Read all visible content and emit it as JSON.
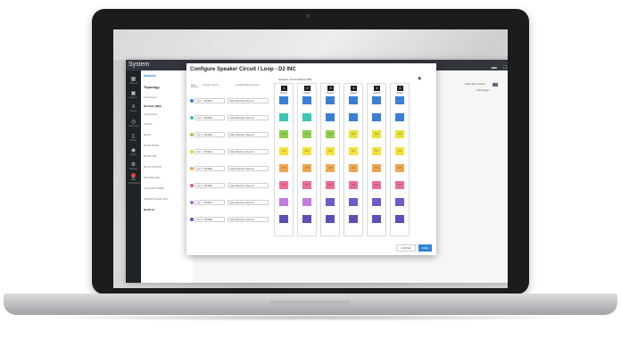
{
  "app": {
    "title": "System",
    "rail": [
      {
        "icon": "grid-icon",
        "label": "Network"
      },
      {
        "icon": "monitor-icon",
        "label": "Devices"
      },
      {
        "icon": "sliders-icon",
        "label": "Zones"
      },
      {
        "icon": "timer-icon",
        "label": "Schedules"
      },
      {
        "icon": "tablet-icon",
        "label": "Panels"
      },
      {
        "icon": "bell-icon",
        "label": "Alarms"
      },
      {
        "icon": "gear-icon",
        "label": "Settings"
      },
      {
        "icon": "alert-icon",
        "label": "Notifications"
      }
    ]
  },
  "sidebar": {
    "title": "Network",
    "subtitle": "Topology",
    "items": [
      "All Devices",
      "D2 Rack (MM)",
      "Add Device",
      "G BOX",
      "RACK",
      "B4 BCSDS8",
      "B5 BCTD8",
      "D8 NC D4NSD",
      "SB AMPLXE4",
      "CLOUDPLX0200",
      "CPARKSTAGE COS",
      "RACK B"
    ]
  },
  "header_right": {
    "label_a": "Adjust Slave Volume",
    "label_b": "Grid Settings"
  },
  "dialog": {
    "title": "Configure Speaker Circuit / Loop - D2 INC",
    "modes_title": "Speaker Circuit Modes (8/8)",
    "col_input": "Input Channel",
    "col_amplifier": "Amplifier Channel",
    "col_backup": "Amplifier Backup Channel",
    "outputs": [
      {
        "num": "1",
        "name": "Default"
      },
      {
        "num": "2",
        "name": "Default"
      },
      {
        "num": "3",
        "name": "Default"
      },
      {
        "num": "4",
        "name": "Default"
      },
      {
        "num": "5",
        "name": "Default"
      },
      {
        "num": "6",
        "name": "Default"
      }
    ],
    "rows": [
      {
        "dot": "#2d7fd3",
        "channel": "CH 1 - MODE1...",
        "backup": "Select Backup Channel",
        "cells": [
          {
            "c": "#3a7fd6",
            "t": ""
          },
          {
            "c": "#3a7fd6",
            "t": ""
          },
          {
            "c": "#3a7fd6",
            "t": ""
          },
          {
            "c": "#3a7fd6",
            "t": ""
          },
          {
            "c": "#3a7fd6",
            "t": ""
          },
          {
            "c": "#3a7fd6",
            "t": ""
          }
        ]
      },
      {
        "dot": "#3ec3b7",
        "channel": "CH 2 - MODE2...",
        "backup": "Select Backup Channel",
        "cells": [
          {
            "c": "#3ec3b7",
            "t": ""
          },
          {
            "c": "#3ec3b7",
            "t": ""
          },
          {
            "c": "#3a7fd6",
            "t": ""
          },
          {
            "c": "#3a7fd6",
            "t": ""
          },
          {
            "c": "#3a7fd6",
            "t": ""
          },
          {
            "c": "#3a7fd6",
            "t": ""
          }
        ]
      },
      {
        "dot": "#8fcf4e",
        "channel": "CH 3 - MODE3...",
        "backup": "Select Backup Channel",
        "cells": [
          {
            "c": "#8fcf4e",
            "t": "1.3"
          },
          {
            "c": "#8fcf4e",
            "t": "1.3"
          },
          {
            "c": "#8fcf4e",
            "t": "1.3"
          },
          {
            "c": "#e7e238",
            "t": "4.3"
          },
          {
            "c": "#e7e238",
            "t": "5.3"
          },
          {
            "c": "#e7e238",
            "t": "6.3"
          }
        ]
      },
      {
        "dot": "#e7d031",
        "channel": "CH 4 - MODE4...",
        "backup": "Select Backup Channel",
        "cells": [
          {
            "c": "#f4e13a",
            "t": "1.4"
          },
          {
            "c": "#f4e13a",
            "t": "2.4"
          },
          {
            "c": "#f4e13a",
            "t": "3.4"
          },
          {
            "c": "#f4e13a",
            "t": "4.4"
          },
          {
            "c": "#f4e13a",
            "t": "5.4"
          },
          {
            "c": "#f4e13a",
            "t": "6.4"
          }
        ]
      },
      {
        "dot": "#f0a24a",
        "channel": "CH 5 - MODE5...",
        "backup": "Select Backup Channel",
        "cells": [
          {
            "c": "#f2a54f",
            "t": "1.5"
          },
          {
            "c": "#f2a54f",
            "t": "2.5"
          },
          {
            "c": "#f2a54f",
            "t": "3.5"
          },
          {
            "c": "#f2a54f",
            "t": "4.5"
          },
          {
            "c": "#f2a54f",
            "t": "5.5"
          },
          {
            "c": "#f2a54f",
            "t": "6.5"
          }
        ]
      },
      {
        "dot": "#ea5a7a",
        "channel": "CH 6 - MODE6...",
        "backup": "Select Backup Channel",
        "cells": [
          {
            "c": "#ec6f8f",
            "t": "1.6"
          },
          {
            "c": "#ec6f8f",
            "t": "2.6"
          },
          {
            "c": "#ec6f8f",
            "t": "3.6"
          },
          {
            "c": "#ec6f8f",
            "t": "4.6"
          },
          {
            "c": "#ec6f8f",
            "t": "5.6"
          },
          {
            "c": "#ec6f8f",
            "t": "6.6"
          }
        ]
      },
      {
        "dot": "#b46fd0",
        "channel": "CH 7 - MODE7...",
        "backup": "Select Backup Channel",
        "cells": [
          {
            "c": "#c27be0",
            "t": ""
          },
          {
            "c": "#c27be0",
            "t": ""
          },
          {
            "c": "#6a5ec8",
            "t": ""
          },
          {
            "c": "#6a5ec8",
            "t": ""
          },
          {
            "c": "#6a5ec8",
            "t": ""
          },
          {
            "c": "#6a5ec8",
            "t": ""
          }
        ]
      },
      {
        "dot": "#5b4fb8",
        "channel": "CH 8 - MODE8...",
        "backup": "Select Backup Channel",
        "cells": [
          {
            "c": "#5b4fb8",
            "t": ""
          },
          {
            "c": "#5b4fb8",
            "t": ""
          },
          {
            "c": "#5b4fb8",
            "t": ""
          },
          {
            "c": "#5b4fb8",
            "t": ""
          },
          {
            "c": "#5b4fb8",
            "t": ""
          },
          {
            "c": "#5b4fb8",
            "t": ""
          }
        ]
      }
    ],
    "cancel": "CANCEL",
    "save": "SAVE"
  }
}
